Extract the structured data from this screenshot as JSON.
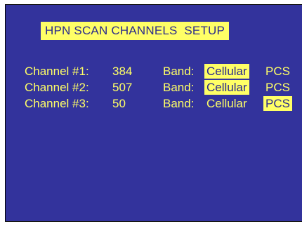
{
  "title": "HPN SCAN CHANNELS  SETUP",
  "band_label": "Band:",
  "band_options": [
    "Cellular",
    "PCS"
  ],
  "channels": [
    {
      "label": "Channel #1:",
      "value": "384",
      "band_selected": "Cellular"
    },
    {
      "label": "Channel #2:",
      "value": "507",
      "band_selected": "Cellular"
    },
    {
      "label": "Channel #3:",
      "value": "50",
      "band_selected": "PCS"
    }
  ],
  "colors": {
    "background": "#33339c",
    "text": "#ffff66",
    "highlight": "#ffff66",
    "highlight_text": "#2a2a8c"
  }
}
